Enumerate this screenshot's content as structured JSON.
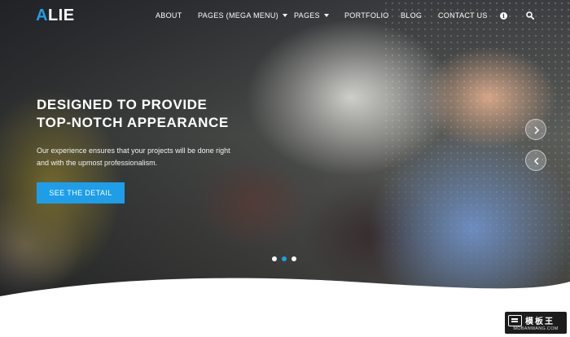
{
  "brand": {
    "logo_accent": "A",
    "logo_rest": "LIE",
    "accent_color": "#1e9ee8"
  },
  "nav": {
    "items": [
      {
        "label": "ABOUT",
        "has_dropdown": false
      },
      {
        "label": "PAGES (MEGA MENU)",
        "has_dropdown": true
      },
      {
        "label": "PAGES",
        "has_dropdown": true
      },
      {
        "label": "PORTFOLIO",
        "has_dropdown": false
      },
      {
        "label": "BLOG",
        "has_dropdown": false
      },
      {
        "label": "CONTACT US",
        "has_dropdown": false
      }
    ],
    "icons": [
      "info-icon",
      "search-icon"
    ]
  },
  "hero": {
    "title_line1": "DESIGNED TO PROVIDE",
    "title_line2": "TOP-NOTCH APPEARANCE",
    "subtitle": "Our experience ensures that your projects will be done right and with the upmost professionalism.",
    "cta_label": "SEE THE DETAIL"
  },
  "slider": {
    "slide_count": 3,
    "active_slide": 2,
    "arrows": [
      "chevron-right-icon",
      "chevron-left-icon"
    ]
  },
  "watermark": {
    "text_cn": "模板王",
    "text_en": "MOBANWANG.COM"
  }
}
